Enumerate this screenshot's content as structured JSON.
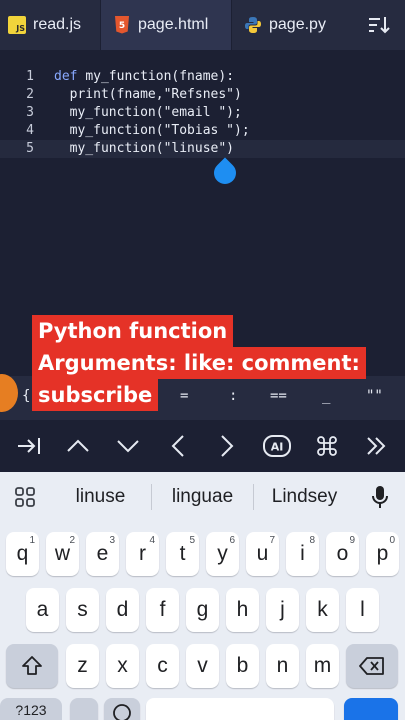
{
  "tabs": [
    {
      "icon": "js-file-icon",
      "icon_text": "JS",
      "label": "read.js"
    },
    {
      "icon": "html5-file-icon",
      "icon_text": "5",
      "label": "page.html"
    },
    {
      "icon": "python-file-icon",
      "icon_text": "",
      "label": "page.py"
    }
  ],
  "editor": {
    "lines": [
      {
        "num": "1",
        "kw": "def ",
        "text": "my_function(fname):"
      },
      {
        "num": "2",
        "kw": "",
        "text": "  print(fname,\"Refsnes\")"
      },
      {
        "num": "3",
        "kw": "",
        "text": "  my_function(\"email \");"
      },
      {
        "num": "4",
        "kw": "",
        "text": "  my_function(\"Tobias \");"
      },
      {
        "num": "5",
        "kw": "",
        "text": "  my_function(\"linuse\")"
      }
    ],
    "active_line": 5
  },
  "caption": {
    "line1": "Python function",
    "line2": "Arguments: like: comment:",
    "line3": "subscribe"
  },
  "symbols": [
    "{",
    "=",
    ":",
    "==",
    "_",
    "\"\""
  ],
  "nav_buttons": [
    "tab-indent-icon",
    "chevron-up-icon",
    "chevron-down-icon",
    "chevron-left-icon",
    "chevron-right-icon",
    "ai-icon",
    "command-icon",
    "double-chevron-right-icon"
  ],
  "nav_ai_label": "AI",
  "keyboard": {
    "suggestions": [
      "linuse",
      "linguae",
      "Lindsey"
    ],
    "row1": [
      {
        "key": "q",
        "hint": "1"
      },
      {
        "key": "w",
        "hint": "2"
      },
      {
        "key": "e",
        "hint": "3"
      },
      {
        "key": "r",
        "hint": "4"
      },
      {
        "key": "t",
        "hint": "5"
      },
      {
        "key": "y",
        "hint": "6"
      },
      {
        "key": "u",
        "hint": "7"
      },
      {
        "key": "i",
        "hint": "8"
      },
      {
        "key": "o",
        "hint": "9"
      },
      {
        "key": "p",
        "hint": "0"
      }
    ],
    "row2": [
      "a",
      "s",
      "d",
      "f",
      "g",
      "h",
      "j",
      "k",
      "l"
    ],
    "row3": [
      "z",
      "x",
      "c",
      "v",
      "b",
      "n",
      "m"
    ],
    "num_key": "?123",
    "accent_color": "#1a73e8"
  },
  "colors": {
    "editor_bg": "#1c2033",
    "tabbar_bg": "#262b40",
    "caption_bg": "#e53227",
    "keyword": "#88a9ff"
  }
}
